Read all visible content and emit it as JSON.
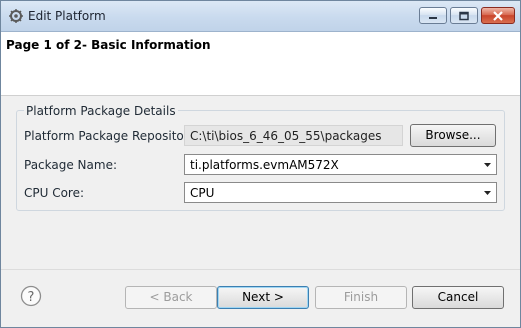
{
  "window": {
    "title": "Edit Platform",
    "icon": "gear-icon",
    "controls": {
      "minimize": "minimize-icon",
      "maximize": "maximize-icon",
      "close": "close-icon"
    }
  },
  "header": {
    "page_title": "Page 1 of 2- Basic Information"
  },
  "details": {
    "group_title": "Platform Package Details",
    "repository_label": "Platform Package Repository:",
    "repository_value": "C:\\ti\\bios_6_46_05_55\\packages",
    "browse_label": "Browse...",
    "package_name_label": "Package Name:",
    "package_name_value": "ti.platforms.evmAM572X",
    "cpu_core_label": "CPU Core:",
    "cpu_core_value": "CPU"
  },
  "footer": {
    "help_icon": "help-icon",
    "back_label": "< Back",
    "next_label": "Next >",
    "finish_label": "Finish",
    "cancel_label": "Cancel"
  },
  "colors": {
    "titlebar": "#c9daee",
    "dialog_background": "#f0f0f0",
    "close_button": "#c9442b",
    "default_button_border": "#3c7fb1"
  }
}
